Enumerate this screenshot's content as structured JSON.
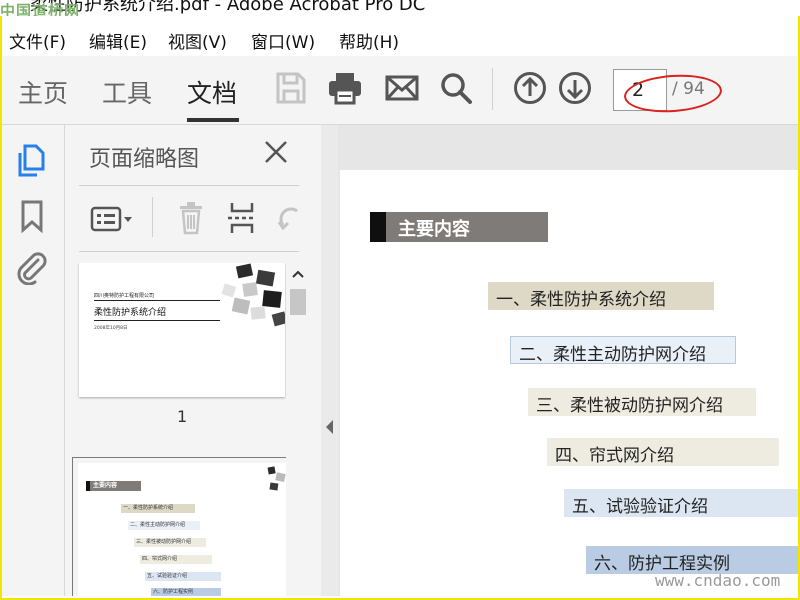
{
  "window": {
    "title": "柔性防护系统介绍.pdf - Adobe Acrobat Pro DC",
    "watermark": "中国道桥网"
  },
  "menu": [
    "文件(F)",
    "编辑(E)",
    "视图(V)",
    "窗口(W)",
    "帮助(H)"
  ],
  "toolbar": {
    "tabs": [
      "主页",
      "工具",
      "文档"
    ],
    "active_tab": "文档",
    "icons": [
      "save-icon",
      "print-icon",
      "email-icon",
      "search-icon",
      "page-up-icon",
      "page-down-icon"
    ],
    "page_current": "2",
    "page_total": "/ 94"
  },
  "nav_icons": [
    "page-thumbnails-icon",
    "bookmark-icon",
    "attachment-icon"
  ],
  "thumbnails_panel": {
    "title": "页面缩略图",
    "tools": [
      "options-menu-icon",
      "delete-icon",
      "insert-page-icon",
      "rotate-icon"
    ],
    "page1": {
      "line1": "四川奥特防护工程有限公司",
      "title": "柔性防护系统介绍",
      "date": "2008年10月8日"
    },
    "page1_label": "1",
    "page2": {
      "head": "主要内容",
      "items": [
        "一、柔性防护系统介绍",
        "二、柔性主动防护网介绍",
        "三、柔性被动防护网介绍",
        "四、帘式网介绍",
        "五、试验验证介绍",
        "六、防护工程实例"
      ]
    }
  },
  "document": {
    "heading": "主要内容",
    "items": [
      "一、柔性防护系统介绍",
      "二、柔性主动防护网介绍",
      "三、柔性被动防护网介绍",
      "四、帘式网介绍",
      "五、试验验证介绍",
      "六、防护工程实例"
    ],
    "colors": {
      "item1": "#ddd9c6",
      "item2": "#eaf0f8",
      "item3": "#eeece1",
      "item4": "#eeece1",
      "item5": "#dce6f2",
      "item6": "#b9cce4",
      "heading": "#7f7b78",
      "frame": "#f2e600",
      "highlight": "#d9221c"
    }
  },
  "footer_watermark": "www.cndao.com"
}
